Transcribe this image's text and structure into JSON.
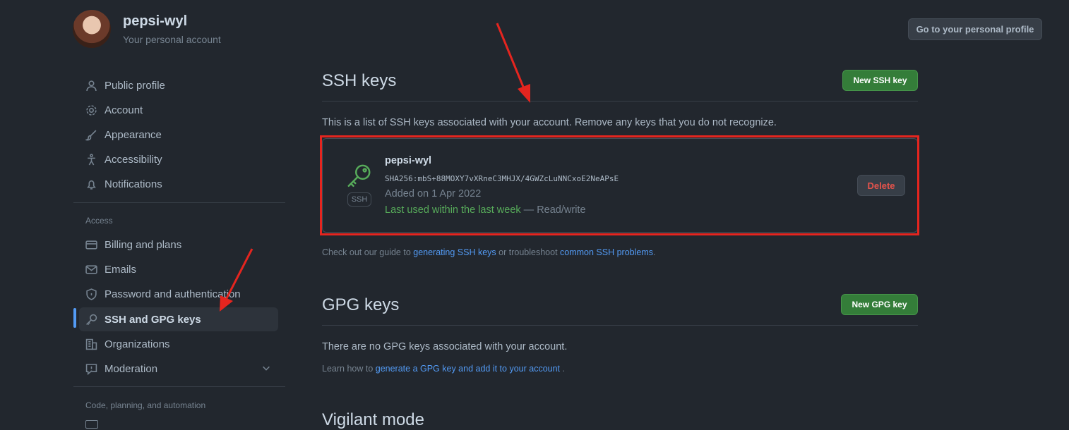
{
  "header": {
    "username": "pepsi-wyl",
    "subtitle": "Your personal account",
    "profile_button": "Go to your personal profile"
  },
  "sidebar": {
    "items": [
      {
        "label": "Public profile",
        "icon": "person-icon"
      },
      {
        "label": "Account",
        "icon": "gear-icon"
      },
      {
        "label": "Appearance",
        "icon": "paintbrush-icon"
      },
      {
        "label": "Accessibility",
        "icon": "accessibility-icon"
      },
      {
        "label": "Notifications",
        "icon": "bell-icon"
      }
    ],
    "access_label": "Access",
    "access_items": [
      {
        "label": "Billing and plans",
        "icon": "credit-card-icon"
      },
      {
        "label": "Emails",
        "icon": "mail-icon"
      },
      {
        "label": "Password and authentication",
        "icon": "shield-lock-icon"
      },
      {
        "label": "SSH and GPG keys",
        "icon": "key-icon",
        "active": true
      },
      {
        "label": "Organizations",
        "icon": "organization-icon"
      },
      {
        "label": "Moderation",
        "icon": "report-icon"
      }
    ],
    "code_label": "Code, planning, and automation"
  },
  "ssh": {
    "title": "SSH keys",
    "new_button": "New SSH key",
    "description": "This is a list of SSH keys associated with your account. Remove any keys that you do not recognize.",
    "key": {
      "name": "pepsi-wyl",
      "fingerprint": "SHA256:mbS+88MOXY7vXRneC3MHJX/4GWZcLuNNCxoE2NeAPsE",
      "added": "Added on 1 Apr 2022",
      "last_used": "Last used within the last week",
      "access": " — Read/write",
      "badge": "SSH",
      "delete_button": "Delete"
    },
    "guide_prefix": "Check out our guide to ",
    "guide_link1": "generating SSH keys",
    "guide_middle": " or troubleshoot ",
    "guide_link2": "common SSH problems",
    "guide_suffix": "."
  },
  "gpg": {
    "title": "GPG keys",
    "new_button": "New GPG key",
    "empty_text": "There are no GPG keys associated with your account.",
    "learn_prefix": "Learn how to ",
    "learn_link": "generate a GPG key and add it to your account",
    "learn_suffix": " ."
  },
  "vigilant": {
    "title": "Vigilant mode"
  },
  "colors": {
    "background": "#22272e",
    "accent_blue": "#539bf5",
    "primary_green": "#347d39",
    "danger_red": "#e5534b",
    "annotation_red": "#e5251f"
  }
}
